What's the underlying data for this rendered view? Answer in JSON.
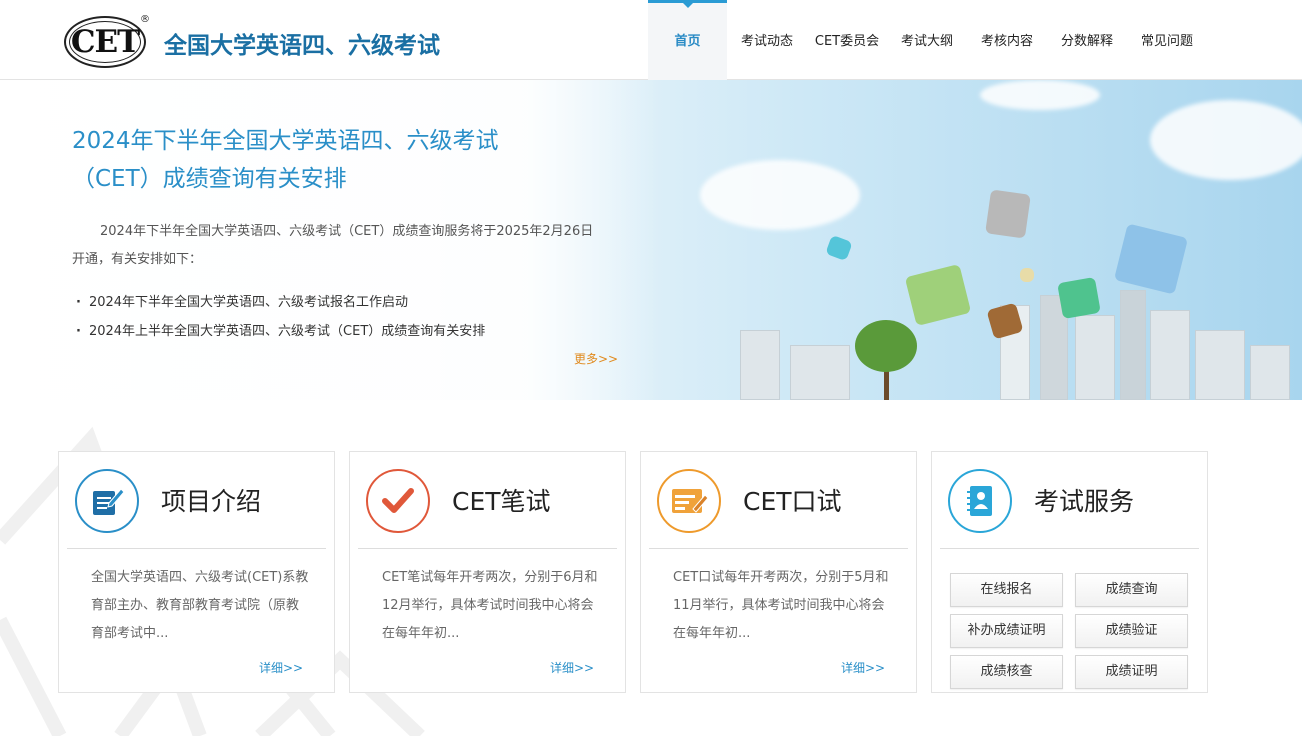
{
  "header": {
    "logo_text": "CET",
    "logo_reg": "®",
    "site_title": "全国大学英语四、六级考试",
    "nav": [
      {
        "label": "首页",
        "active": true
      },
      {
        "label": "考试动态"
      },
      {
        "label": "CET委员会"
      },
      {
        "label": "考试大纲"
      },
      {
        "label": "考核内容"
      },
      {
        "label": "分数解释"
      },
      {
        "label": "常见问题"
      }
    ]
  },
  "banner": {
    "title": "2024年下半年全国大学英语四、六级考试（CET）成绩查询有关安排",
    "paragraph": "2024年下半年全国大学英语四、六级考试（CET）成绩查询服务将于2025年2月26日开通，有关安排如下：",
    "list": [
      "2024年下半年全国大学英语四、六级考试报名工作启动",
      "2024年上半年全国大学英语四、六级考试（CET）成绩查询有关安排"
    ],
    "more": "更多>>"
  },
  "cards": [
    {
      "title": "项目介绍",
      "desc": "全国大学英语四、六级考试(CET)系教育部主办、教育部教育考试院（原教育部考试中...",
      "more": "详细>>",
      "icon": "document-edit-icon",
      "color": "#2a8fc8"
    },
    {
      "title": "CET笔试",
      "desc": "CET笔试每年开考两次，分别于6月和12月举行，具体考试时间我中心将会在每年年初...",
      "more": "详细>>",
      "icon": "checkmark-icon",
      "color": "#e0583a"
    },
    {
      "title": "CET口试",
      "desc": "CET口试每年开考两次，分别于5月和11月举行，具体考试时间我中心将会在每年年初...",
      "more": "详细>>",
      "icon": "screen-edit-icon",
      "color": "#ee9a2c"
    },
    {
      "title": "考试服务",
      "icon": "id-book-icon",
      "color": "#2aa6d8"
    }
  ],
  "services": [
    "在线报名",
    "成绩查询",
    "补办成绩证明",
    "成绩验证",
    "成绩核查",
    "成绩证明"
  ]
}
